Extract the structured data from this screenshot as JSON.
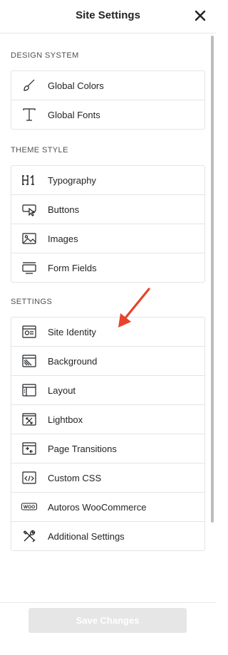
{
  "header": {
    "title": "Site Settings"
  },
  "sections": {
    "design_system": {
      "label": "DESIGN SYSTEM",
      "items": [
        {
          "label": "Global Colors",
          "icon": "brush-icon"
        },
        {
          "label": "Global Fonts",
          "icon": "typeface-icon"
        }
      ]
    },
    "theme_style": {
      "label": "THEME STYLE",
      "items": [
        {
          "label": "Typography",
          "icon": "h1-icon"
        },
        {
          "label": "Buttons",
          "icon": "button-cursor-icon"
        },
        {
          "label": "Images",
          "icon": "image-icon"
        },
        {
          "label": "Form Fields",
          "icon": "form-field-icon"
        }
      ]
    },
    "settings": {
      "label": "SETTINGS",
      "items": [
        {
          "label": "Site Identity",
          "icon": "site-identity-icon"
        },
        {
          "label": "Background",
          "icon": "background-icon"
        },
        {
          "label": "Layout",
          "icon": "layout-icon"
        },
        {
          "label": "Lightbox",
          "icon": "lightbox-icon"
        },
        {
          "label": "Page Transitions",
          "icon": "page-transitions-icon"
        },
        {
          "label": "Custom CSS",
          "icon": "custom-css-icon"
        },
        {
          "label": "Autoros WooCommerce",
          "icon": "woocommerce-icon"
        },
        {
          "label": "Additional Settings",
          "icon": "tools-icon"
        }
      ]
    }
  },
  "footer": {
    "save_label": "Save Changes"
  },
  "colors": {
    "annotation_arrow": "#e8432b",
    "disabled_button": "#e6e6e6"
  }
}
